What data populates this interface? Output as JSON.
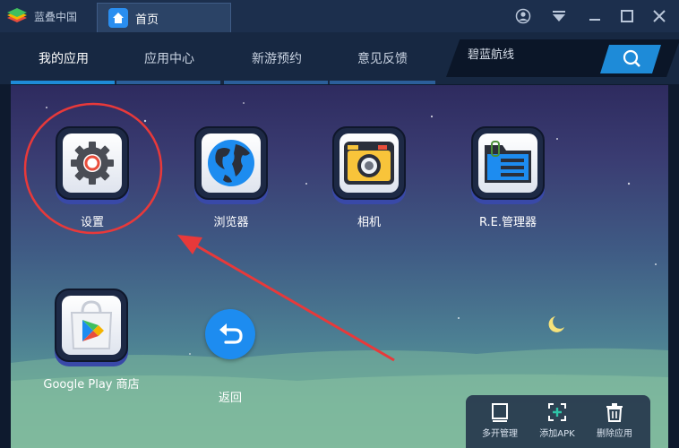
{
  "titlebar": {
    "brand": "蓝叠中国",
    "home_tab": "首页"
  },
  "nav": {
    "tabs": [
      {
        "label": "我的应用",
        "active": true
      },
      {
        "label": "应用中心",
        "active": false
      },
      {
        "label": "新游预约",
        "active": false
      },
      {
        "label": "意见反馈",
        "active": false
      }
    ],
    "search_text": "碧蓝航线"
  },
  "apps": [
    {
      "label": "设置",
      "icon": "settings-gear-icon"
    },
    {
      "label": "浏览器",
      "icon": "globe-icon"
    },
    {
      "label": "相机",
      "icon": "camera-icon"
    },
    {
      "label": "R.E.管理器",
      "icon": "folder-icon"
    },
    {
      "label": "Google Play 商店",
      "icon": "play-store-icon"
    },
    {
      "label": "返回",
      "icon": "back-arrow-icon"
    }
  ],
  "tools": [
    {
      "label": "多开管理",
      "icon": "multi-instance-icon"
    },
    {
      "label": "添加APK",
      "icon": "add-apk-icon"
    },
    {
      "label": "删除应用",
      "icon": "trash-icon"
    }
  ],
  "colors": {
    "accent": "#1d8cf0",
    "highlight_circle": "#e8393a",
    "tab_underline": "#1e8bd8"
  }
}
